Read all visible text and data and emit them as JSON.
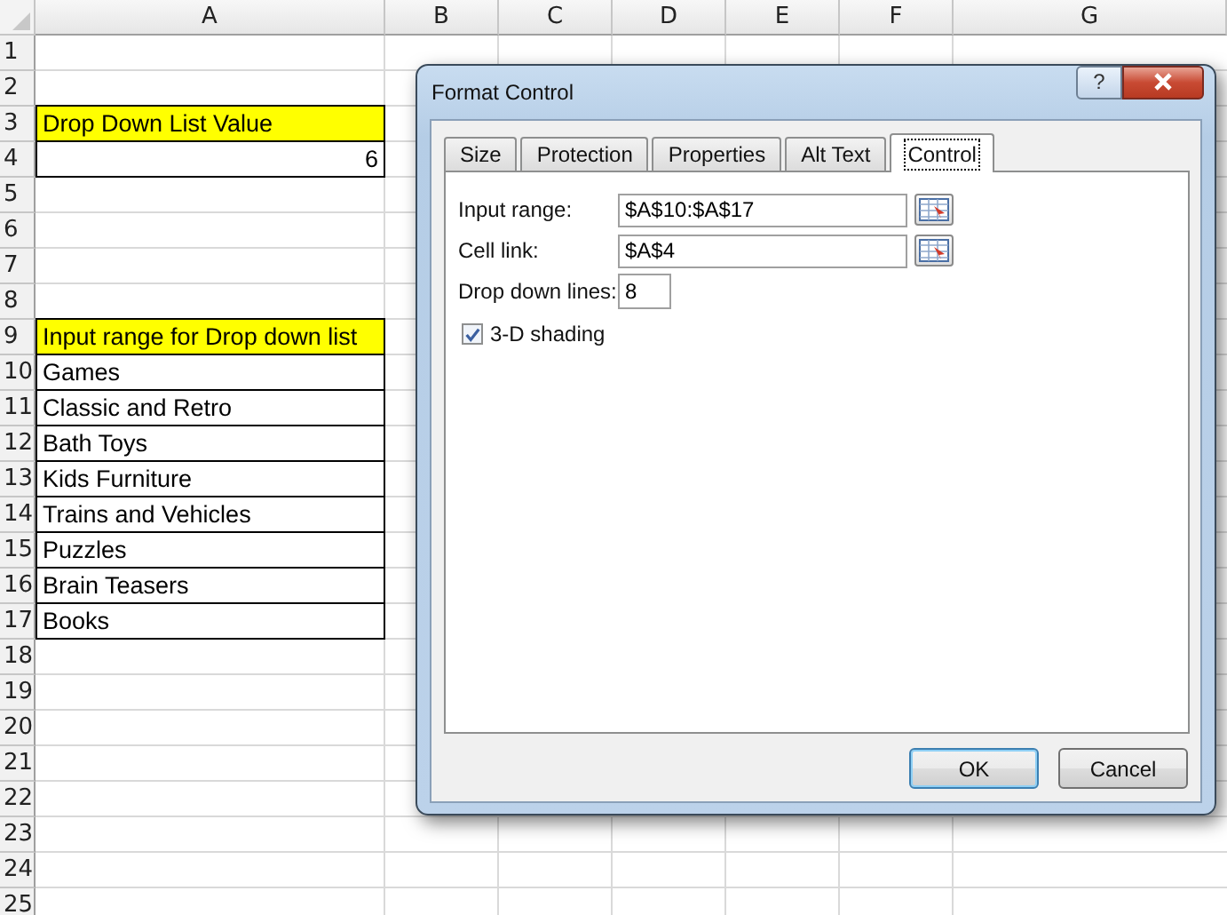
{
  "sheet": {
    "columns": [
      "A",
      "B",
      "C",
      "D",
      "E",
      "F",
      "G"
    ],
    "rows": [
      {
        "number": "1",
        "kind": "blank"
      },
      {
        "number": "2",
        "kind": "blank"
      },
      {
        "number": "3",
        "kind": "label",
        "text": "Drop Down List Value"
      },
      {
        "number": "4",
        "kind": "number",
        "text": "6"
      },
      {
        "number": "5",
        "kind": "blank"
      },
      {
        "number": "6",
        "kind": "blank"
      },
      {
        "number": "7",
        "kind": "blank"
      },
      {
        "number": "8",
        "kind": "blank"
      },
      {
        "number": "9",
        "kind": "label",
        "text": "Input range for Drop down list"
      },
      {
        "number": "10",
        "kind": "item",
        "text": "Games"
      },
      {
        "number": "11",
        "kind": "item",
        "text": "Classic and Retro"
      },
      {
        "number": "12",
        "kind": "item",
        "text": "Bath Toys"
      },
      {
        "number": "13",
        "kind": "item",
        "text": "Kids Furniture"
      },
      {
        "number": "14",
        "kind": "item",
        "text": "Trains and Vehicles"
      },
      {
        "number": "15",
        "kind": "item",
        "text": "Puzzles"
      },
      {
        "number": "16",
        "kind": "item",
        "text": "Brain Teasers"
      },
      {
        "number": "17",
        "kind": "item",
        "text": "Books"
      },
      {
        "number": "18",
        "kind": "blank"
      },
      {
        "number": "19",
        "kind": "blank"
      },
      {
        "number": "20",
        "kind": "blank"
      },
      {
        "number": "21",
        "kind": "blank"
      },
      {
        "number": "22",
        "kind": "blank"
      },
      {
        "number": "23",
        "kind": "blank"
      },
      {
        "number": "24",
        "kind": "blank"
      },
      {
        "number": "25",
        "kind": "blank"
      }
    ]
  },
  "dialog": {
    "title": "Format Control",
    "help": "?",
    "tabs": [
      {
        "label": "Size",
        "selected": false
      },
      {
        "label": "Protection",
        "selected": false
      },
      {
        "label": "Properties",
        "selected": false
      },
      {
        "label": "Alt Text",
        "selected": false
      },
      {
        "label": "Control",
        "selected": true
      }
    ],
    "fields": [
      {
        "label": "Input range:",
        "value": "$A$10:$A$17",
        "kind": "range"
      },
      {
        "label": "Cell link:",
        "value": "$A$4",
        "kind": "range"
      },
      {
        "label": "Drop down lines:",
        "value": "8",
        "kind": "number"
      }
    ],
    "checkbox": {
      "label": "3-D shading",
      "checked": true
    },
    "buttons": [
      {
        "label": "OK",
        "default": true
      },
      {
        "label": "Cancel",
        "default": false
      }
    ]
  }
}
